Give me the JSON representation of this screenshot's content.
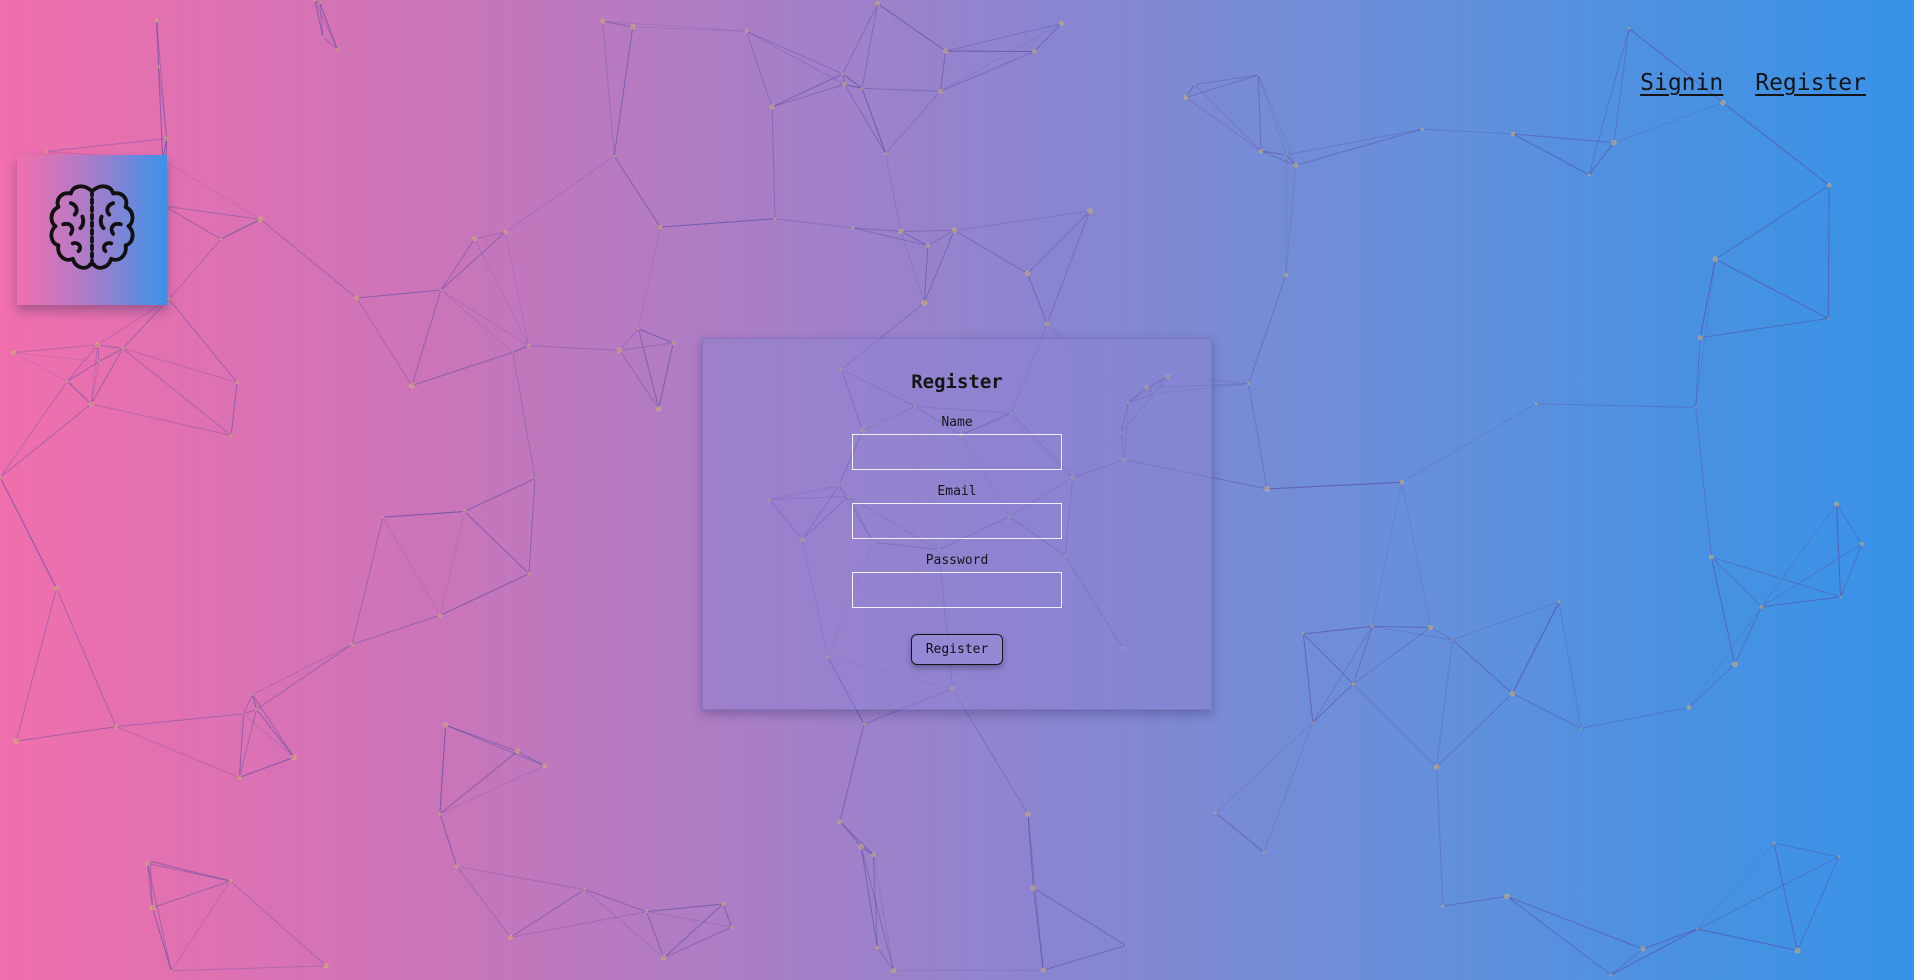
{
  "nav": {
    "signin_label": "Signin",
    "register_label": "Register"
  },
  "logo": {
    "icon": "brain-icon"
  },
  "form": {
    "title": "Register",
    "name_label": "Name",
    "name_value": "",
    "email_label": "Email",
    "email_value": "",
    "password_label": "Password",
    "password_value": "",
    "submit_label": "Register"
  },
  "colors": {
    "gradient_left": "#f06fac",
    "gradient_right": "#3792e8",
    "network_line": "#5a4fa8",
    "network_node": "#d7b86a"
  }
}
